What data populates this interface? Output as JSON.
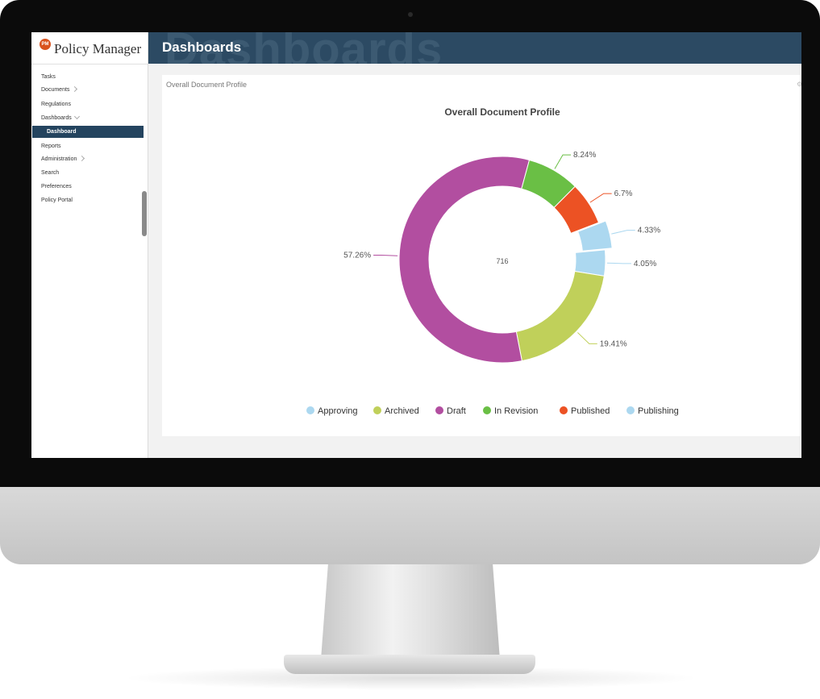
{
  "app": {
    "name": "Policy Manager",
    "logo_text": "PM"
  },
  "header": {
    "title": "Dashboards",
    "watermark": "Dashboards"
  },
  "sidebar": {
    "items": [
      {
        "label": "Tasks"
      },
      {
        "label": "Documents"
      },
      {
        "label": "Regulations"
      },
      {
        "label": "Dashboards"
      },
      {
        "label": "Dashboard"
      },
      {
        "label": "Reports"
      },
      {
        "label": "Administration"
      },
      {
        "label": "Search"
      },
      {
        "label": "Preferences"
      },
      {
        "label": "Policy Portal"
      }
    ]
  },
  "panel": {
    "title": "Overall Document Profile"
  },
  "colors": {
    "sidebar_active": "#24445f",
    "topbar": "#2c4a63"
  },
  "chart_data": {
    "type": "pie",
    "title": "Overall Document Profile",
    "center_label": "716",
    "categories": [
      "Approving",
      "Archived",
      "Draft",
      "In Revision",
      "Published",
      "Publishing"
    ],
    "values": [
      4.05,
      19.41,
      57.26,
      8.24,
      6.7,
      4.33
    ],
    "value_labels": [
      "4.05%",
      "19.41%",
      "57.26%",
      "8.24%",
      "6.7%",
      "4.33%"
    ],
    "colors": [
      "#acd8f0",
      "#c0d05a",
      "#b24ea0",
      "#6abf45",
      "#ec5224",
      "#acd8f0"
    ],
    "legend": "bottom"
  }
}
